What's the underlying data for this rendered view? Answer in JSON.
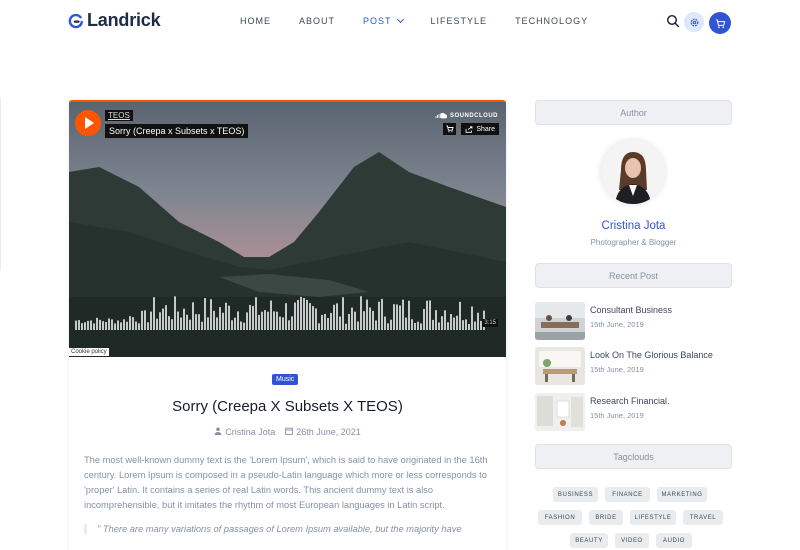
{
  "header": {
    "brand": "Landrick",
    "nav": [
      {
        "label": "Home"
      },
      {
        "label": "About"
      },
      {
        "label": "Post"
      },
      {
        "label": "Lifestyle"
      },
      {
        "label": "Technology"
      }
    ],
    "active_nav": "Post",
    "icons": [
      "search-icon",
      "gear-icon",
      "cart-icon"
    ],
    "accent": "#2f55d4"
  },
  "player": {
    "artist": "TEOS",
    "track_title": "Sorry (Creepa x Subsets x TEOS)",
    "brand": "SOUNDCLOUD",
    "share_label": "Share",
    "duration": "3:15",
    "cookie_label": "Cookie policy",
    "accent": "#ff5500"
  },
  "post": {
    "category": "Music",
    "title": "Sorry (Creepa X Subsets X TEOS)",
    "author": "Cristina Jota",
    "date": "26th June, 2021",
    "body": "The most well-known dummy text is the 'Lorem Ipsum', which is said to have originated in the 16th century. Lorem Ipsum is composed in a pseudo-Latin language which more or less corresponds to 'proper' Latin. It contains a series of real Latin words. This ancient dummy text is also incomprehensible, but it imitates the rhythm of most European languages in Latin script.",
    "quote": "\" There are many variations of passages of Lorem Ipsum available, but the majority have"
  },
  "sidebar": {
    "author_heading": "Author",
    "author_name": "Cristina Jota",
    "author_role": "Photographer & Blogger",
    "recent_heading": "Recent Post",
    "recent_posts": [
      {
        "title": "Consultant Business",
        "date": "15th June, 2019"
      },
      {
        "title": "Look On The Glorious Balance",
        "date": "15th June, 2019"
      },
      {
        "title": "Research Financial.",
        "date": "15th June, 2019"
      }
    ],
    "tags_heading": "Tagclouds",
    "tags": [
      "Business",
      "Finance",
      "Marketing",
      "Fashion",
      "Bride",
      "Lifestyle",
      "Travel",
      "Beauty",
      "Video",
      "Audio"
    ]
  }
}
